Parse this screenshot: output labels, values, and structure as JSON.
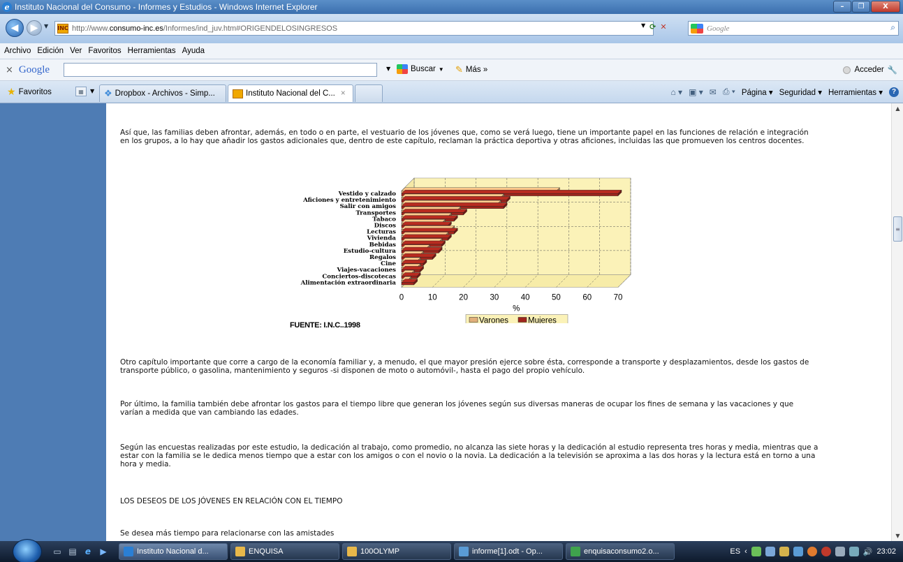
{
  "window": {
    "title": "Instituto Nacional del Consumo - Informes y Estudios - Windows Internet Explorer",
    "controls": {
      "minimize": "–",
      "maximize": "❐",
      "close": "X"
    }
  },
  "address": {
    "url_prefix": "http://www.",
    "url_domain": "consumo-inc.es",
    "url_path": "/Informes/ind_juv.htm#ORIGENDELOSINGRESOS",
    "search_placeholder": "Google"
  },
  "menu": [
    "Archivo",
    "Edición",
    "Ver",
    "Favoritos",
    "Herramientas",
    "Ayuda"
  ],
  "google_toolbar": {
    "logo": "Google",
    "search_label": "Buscar",
    "more_label": "Más »",
    "signin_label": "Acceder"
  },
  "favorites_bar": {
    "favorites_label": "Favoritos",
    "tabs": [
      {
        "label": "Dropbox - Archivos - Simp...",
        "active": false
      },
      {
        "label": "Instituto Nacional del C...",
        "active": true
      }
    ],
    "commands": {
      "page": "Página ▾",
      "security": "Seguridad ▾",
      "tools": "Herramientas ▾"
    }
  },
  "content": {
    "paragraphs": [
      "Así que, las familias deben afrontar, además, en todo o en parte, el vestuario de los jóvenes que, como se verá luego, tiene un importante papel en las funciones de relación e integración en los grupos, a lo hay que añadir los gastos adicionales que, dentro de este capítulo, reclaman la práctica deportiva y otras aficiones, incluidas las que promueven los centros docentes.",
      "Otro capítulo importante que corre a cargo de la economía familiar y, a menudo, el que mayor presión ejerce sobre ésta, corresponde a transporte y desplazamientos, desde los gastos de transporte público, o gasolina, mantenimiento y seguros -si disponen de moto o automóvil-, hasta el pago del propio vehículo.",
      "Por último, la familia también debe afrontar los gastos para el tiempo libre que generan los jóvenes según sus diversas maneras de ocupar los fines de semana y las vacaciones y que varían a medida que van cambiando las edades.",
      "Según las encuestas realizadas por este estudio, la dedicación al trabajo, como promedio, no alcanza las siete horas y la dedicación al estudio representa tres horas y media, mientras que a estar con la familia se le dedica menos tiempo que a estar con los amigos o con el novio o la novia. La dedicación a la televisión se aproxima a las dos horas y la lectura está en torno a una hora y media.",
      "LOS DESEOS DE LOS JÓVENES EN RELACIÓN CON EL TIEMPO",
      "Se desea más tiempo para relacionarse con las amistades"
    ],
    "source": "FUENTE: I.N.C..1998"
  },
  "chart_data": {
    "type": "bar",
    "orientation": "horizontal",
    "style": "3d",
    "categories": [
      "Vestido y calzado",
      "Aficiones y entretenimiento",
      "Salir con amigos",
      "Transportes",
      "Tabaco",
      "Discos",
      "Lecturas",
      "Vivienda",
      "Bebidas",
      "Estudio-cultura",
      "Regalos",
      "Cine",
      "Viajes-vacaciones",
      "Conciertos-discotecas",
      "Alimentación extraordinaria"
    ],
    "series": [
      {
        "name": "Varones",
        "color": "#e2b07a",
        "values": [
          50,
          32,
          31,
          18,
          15,
          13,
          16,
          14,
          12,
          8,
          6,
          5,
          5,
          3,
          2
        ]
      },
      {
        "name": "Mujeres",
        "color": "#a0251c",
        "values": [
          70,
          34,
          33,
          20,
          17,
          15,
          17,
          15,
          13,
          12,
          10,
          7,
          6,
          5,
          4
        ]
      }
    ],
    "xlabel": "%",
    "xlim": [
      0,
      70
    ],
    "xticks": [
      0,
      10,
      20,
      30,
      40,
      50,
      60,
      70
    ],
    "grid": true,
    "legend": "bottom"
  },
  "taskbar": {
    "buttons": [
      {
        "label": "Instituto Nacional d...",
        "icon_color": "#2a7fd4",
        "active": true
      },
      {
        "label": "ENQUISA",
        "icon_color": "#e8b84a",
        "active": false
      },
      {
        "label": "100OLYMP",
        "icon_color": "#e8b84a",
        "active": false
      },
      {
        "label": "informe[1].odt - Op...",
        "icon_color": "#5a9bd5",
        "active": false
      },
      {
        "label": "enquisaconsumo2.o...",
        "icon_color": "#3fa34d",
        "active": false
      }
    ],
    "lang": "ES",
    "clock": "23:02"
  }
}
